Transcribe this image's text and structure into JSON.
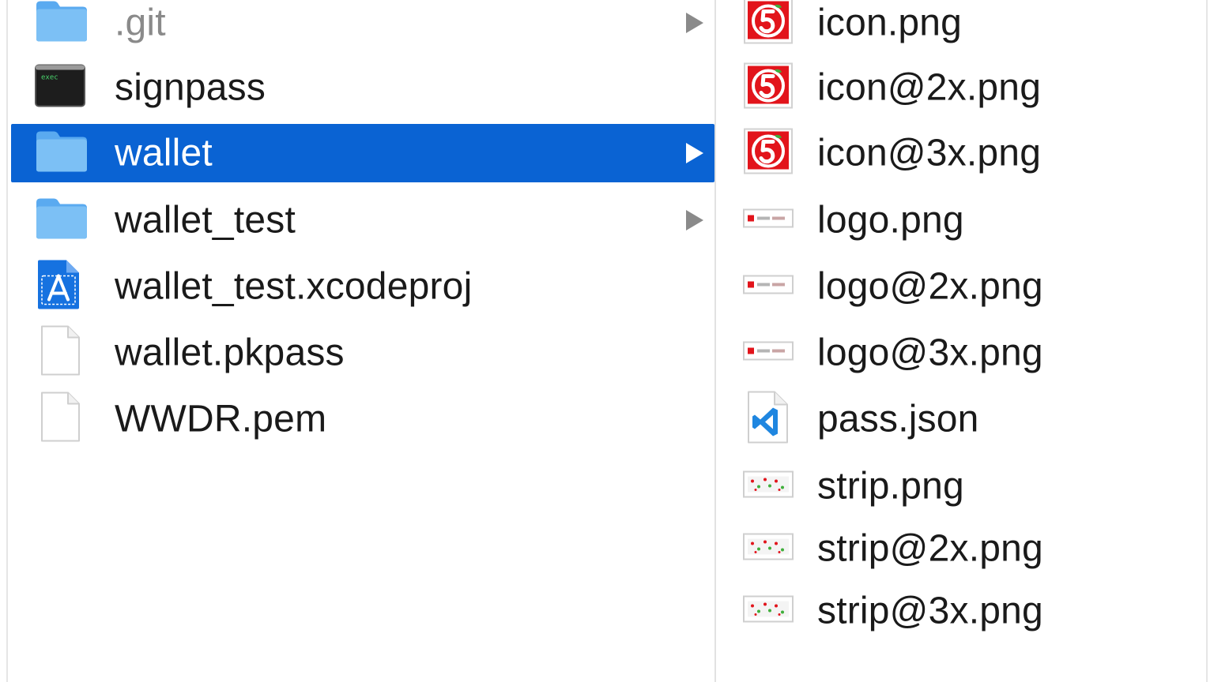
{
  "left_column": {
    "items": [
      {
        "label": ".git",
        "kind": "folder",
        "icon": "folder-icon",
        "has_children": true,
        "dim": true
      },
      {
        "label": "signpass",
        "kind": "exec",
        "icon": "terminal-exec-icon",
        "icon_text": "exec",
        "has_children": false
      },
      {
        "label": "wallet",
        "kind": "folder",
        "icon": "folder-icon",
        "has_children": true,
        "selected": true
      },
      {
        "label": "wallet_test",
        "kind": "folder",
        "icon": "folder-icon",
        "has_children": true
      },
      {
        "label": "wallet_test.xcodeproj",
        "kind": "xcodeproj",
        "icon": "xcode-project-icon",
        "has_children": false
      },
      {
        "label": "wallet.pkpass",
        "kind": "document",
        "icon": "document-icon",
        "has_children": false
      },
      {
        "label": "WWDR.pem",
        "kind": "document",
        "icon": "document-icon",
        "has_children": false
      }
    ]
  },
  "right_column": {
    "items": [
      {
        "label": "icon.png",
        "icon": "red-logo-thumbnail-icon"
      },
      {
        "label": "icon@2x.png",
        "icon": "red-logo-thumbnail-icon"
      },
      {
        "label": "icon@3x.png",
        "icon": "red-logo-thumbnail-icon"
      },
      {
        "label": "logo.png",
        "icon": "logo-banner-thumbnail-icon"
      },
      {
        "label": "logo@2x.png",
        "icon": "logo-banner-thumbnail-icon"
      },
      {
        "label": "logo@3x.png",
        "icon": "logo-banner-thumbnail-icon"
      },
      {
        "label": "pass.json",
        "icon": "vscode-json-icon"
      },
      {
        "label": "strip.png",
        "icon": "strip-thumbnail-icon"
      },
      {
        "label": "strip@2x.png",
        "icon": "strip-thumbnail-icon"
      },
      {
        "label": "strip@3x.png",
        "icon": "strip-thumbnail-icon"
      }
    ]
  },
  "colors": {
    "selection": "#0a63d3",
    "folder": "#6fb8ef",
    "text": "#1a1a1a",
    "dim_text": "#8a8a8a",
    "chevron": "#8a8a8a",
    "brand_red": "#e2141b"
  }
}
